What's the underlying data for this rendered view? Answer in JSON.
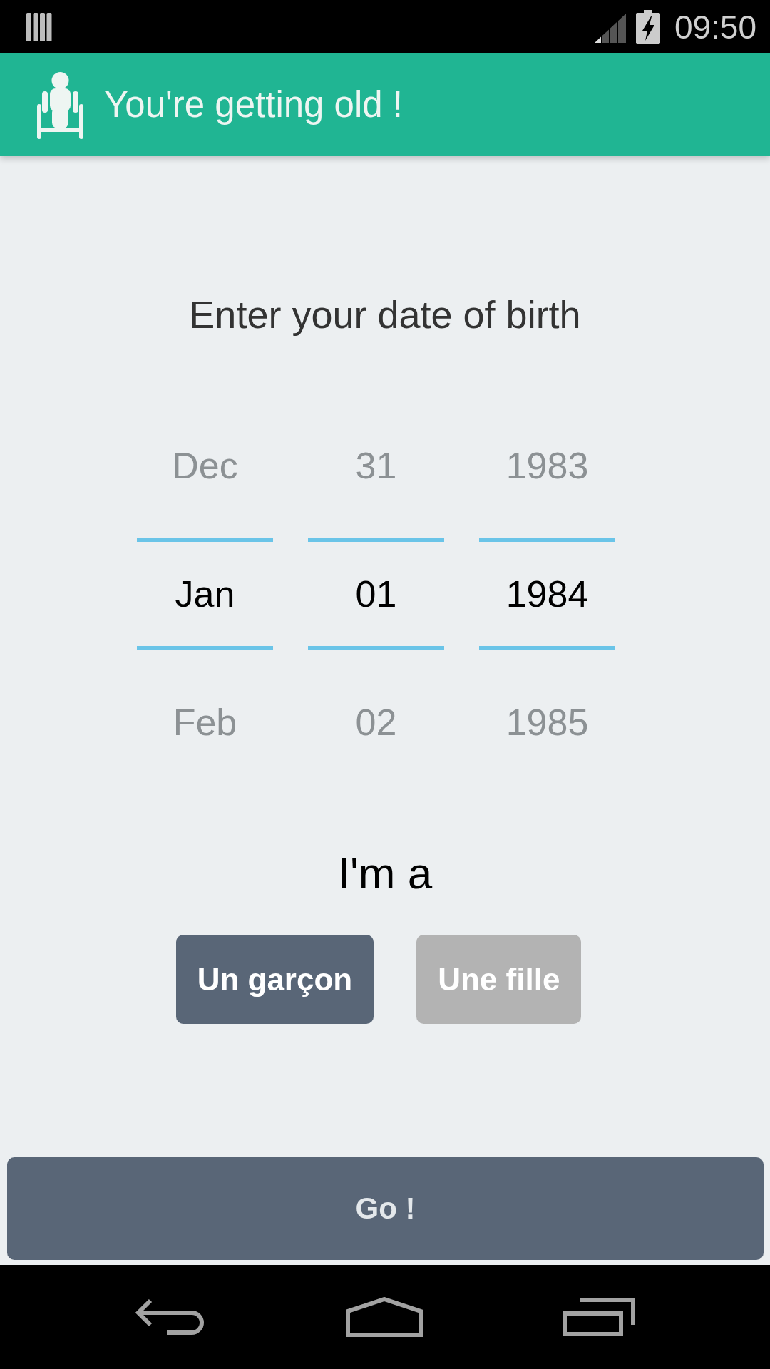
{
  "status_bar": {
    "time": "09:50"
  },
  "app_bar": {
    "title": "You're getting old !"
  },
  "prompt": "Enter your date of birth",
  "date_picker": {
    "columns": [
      {
        "items": [
          {
            "label": "Dec",
            "selected": false
          },
          {
            "label": "Jan",
            "selected": true
          },
          {
            "label": "Feb",
            "selected": false
          }
        ]
      },
      {
        "items": [
          {
            "label": "31",
            "selected": false
          },
          {
            "label": "01",
            "selected": true
          },
          {
            "label": "02",
            "selected": false
          }
        ]
      },
      {
        "items": [
          {
            "label": "1983",
            "selected": false
          },
          {
            "label": "1984",
            "selected": true
          },
          {
            "label": "1985",
            "selected": false
          }
        ]
      }
    ]
  },
  "gender": {
    "label": "I'm a",
    "options": [
      {
        "label": "Un garçon",
        "selected": true
      },
      {
        "label": "Une fille",
        "selected": false
      }
    ]
  },
  "go_button": {
    "label": "Go !"
  }
}
